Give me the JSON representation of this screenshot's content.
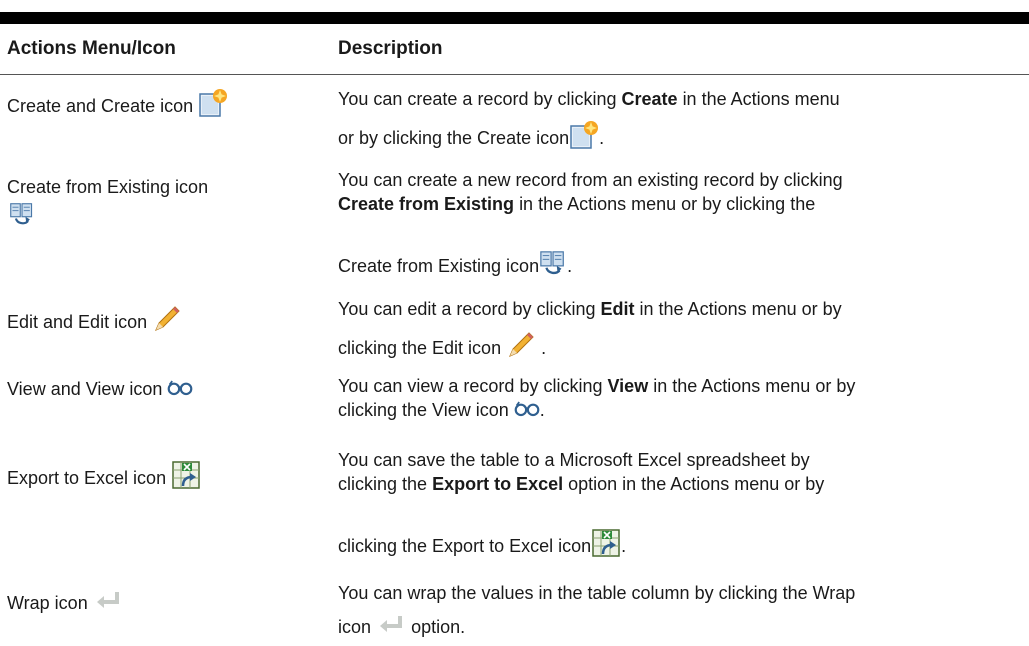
{
  "header": {
    "col1": "Actions Menu/Icon",
    "col2": "Description"
  },
  "rows": [
    {
      "label": "Create and Create icon",
      "icon": "create-icon",
      "desc": {
        "pre": "You can create a record by clicking",
        "bold": "Create",
        "post": "in the Actions menu",
        "line2_pre": "or by clicking the Create icon",
        "line2_post": "."
      }
    },
    {
      "label": "Create from Existing icon",
      "icon": "create-from-existing-icon",
      "desc": {
        "line1": "You can create a new record from an existing record by clicking",
        "bold": "Create from Existing",
        "post": "in the Actions menu or by clicking the",
        "line3_pre": "Create from Existing icon",
        "line3_post": "."
      }
    },
    {
      "label": "Edit and Edit icon",
      "icon": "edit-icon",
      "desc": {
        "pre": "You can edit a record by clicking",
        "bold": "Edit",
        "post": "in the Actions menu or by",
        "line2_pre": "clicking the Edit icon",
        "line2_post": "."
      }
    },
    {
      "label": "View and View icon",
      "icon": "view-icon",
      "desc": {
        "pre": "You can view a record by clicking",
        "bold": "View",
        "post": "in the Actions menu or by",
        "line2_pre": "clicking the View icon",
        "line2_post": "."
      }
    },
    {
      "label": "Export to Excel icon",
      "icon": "export-to-excel-icon",
      "desc": {
        "line1": "You can save the table to a Microsoft Excel spreadsheet by",
        "pre": "clicking the",
        "bold": "Export to Excel",
        "post": "option in the Actions menu or by",
        "line3_pre": "clicking the Export to Excel icon",
        "line3_post": "."
      }
    },
    {
      "label": "Wrap icon",
      "icon": "wrap-icon",
      "desc": {
        "line1": "You can wrap the values in the table column by clicking the Wrap",
        "line2_pre": "icon",
        "line2_post": "option."
      }
    }
  ],
  "colors": {
    "rule": "#000000",
    "text": "#1a1a1a"
  }
}
